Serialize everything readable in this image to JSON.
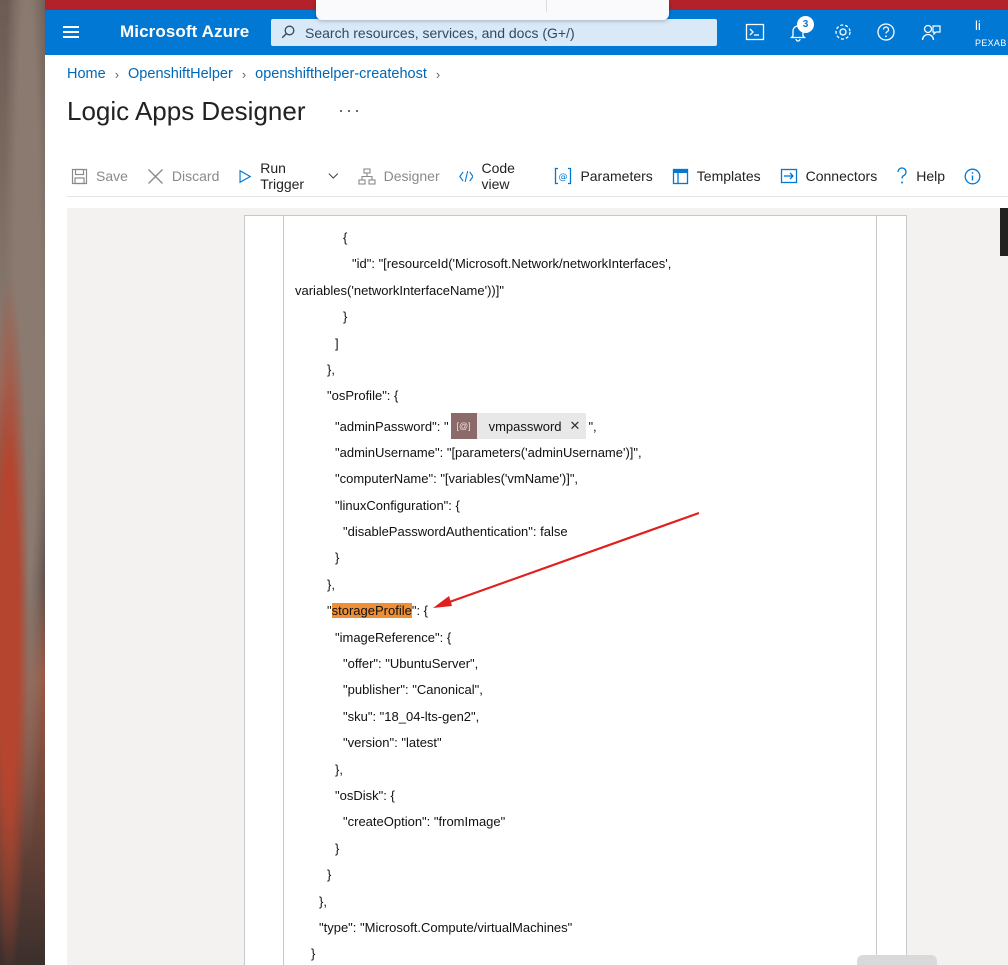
{
  "header": {
    "brand": "Microsoft Azure",
    "search_placeholder": "Search resources, services, and docs (G+/)",
    "notifications_count": "3",
    "account_initial": "li",
    "account_tenant": "PEXAB"
  },
  "breadcrumb": {
    "items": [
      "Home",
      "OpenshiftHelper",
      "openshifthelper-createhost"
    ]
  },
  "page": {
    "title": "Logic Apps Designer",
    "more": "···"
  },
  "toolbar": {
    "save": "Save",
    "discard": "Discard",
    "run_trigger": "Run Trigger",
    "designer": "Designer",
    "code_view": "Code view",
    "parameters": "Parameters",
    "templates": "Templates",
    "connectors": "Connectors",
    "help": "Help"
  },
  "code": {
    "l1": "{",
    "l2a": "\"id\": \"[resourceId('Microsoft.Network/networkInterfaces',",
    "l2b": "variables('networkInterfaceName'))]\"",
    "l3": "}",
    "l4": "]",
    "l5": "},",
    "l6": "\"osProfile\": {",
    "l7_pre": "\"adminPassword\": \"",
    "l7_token": "vmpassword",
    "l7_token_icon": "[@]",
    "l7_post": "\",",
    "l8": "\"adminUsername\": \"[parameters('adminUsername')]\",",
    "l9": "\"computerName\": \"[variables('vmName')]\",",
    "l10": "\"linuxConfiguration\": {",
    "l11": "\"disablePasswordAuthentication\": false",
    "l12": "}",
    "l13": "},",
    "l14_pre": "\"",
    "l14_hl": "storageProfile",
    "l14_post": "\": {",
    "l15": "\"imageReference\": {",
    "l16": "\"offer\": \"UbuntuServer\",",
    "l17": "\"publisher\": \"Canonical\",",
    "l18": "\"sku\": \"18_04-lts-gen2\",",
    "l19": "\"version\": \"latest\"",
    "l20": "},",
    "l21": "\"osDisk\": {",
    "l22": "\"createOption\": \"fromImage\"",
    "l23": "}",
    "l24": "}",
    "l25": "},",
    "l26": "\"type\": \"Microsoft.Compute/virtualMachines\"",
    "l27": "}"
  },
  "colors": {
    "azure_blue": "#0078d4",
    "highlight": "#ef8f35",
    "annotation_arrow": "#e0201e",
    "link": "#0067b8"
  }
}
